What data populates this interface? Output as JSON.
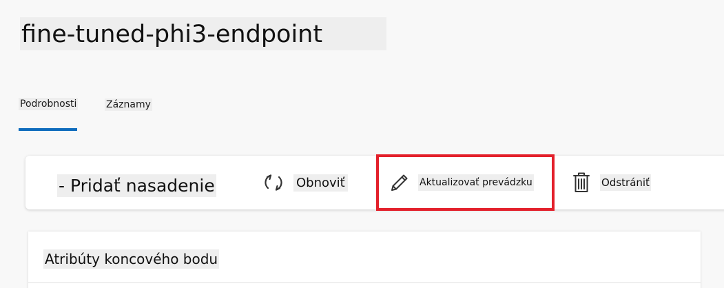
{
  "header": {
    "title": "fine-tuned-phi3-endpoint"
  },
  "tabs": [
    {
      "label": "Podrobnosti",
      "active": true
    },
    {
      "label": "Záznamy",
      "active": false
    }
  ],
  "toolbar": {
    "add_deployment_label": "- Pridať nasadenie",
    "refresh_label": "Obnoviť",
    "update_traffic_label": "Aktualizovať prevádzku",
    "delete_label": "Odstrániť",
    "icons": {
      "refresh": "refresh-icon",
      "update": "pencil-icon",
      "delete": "trash-icon"
    }
  },
  "attributes_card": {
    "title": "Atribúty koncového bodu"
  },
  "colors": {
    "accent": "#0f6cbd",
    "highlight": "#e3202b",
    "background": "#f8f8f8"
  }
}
